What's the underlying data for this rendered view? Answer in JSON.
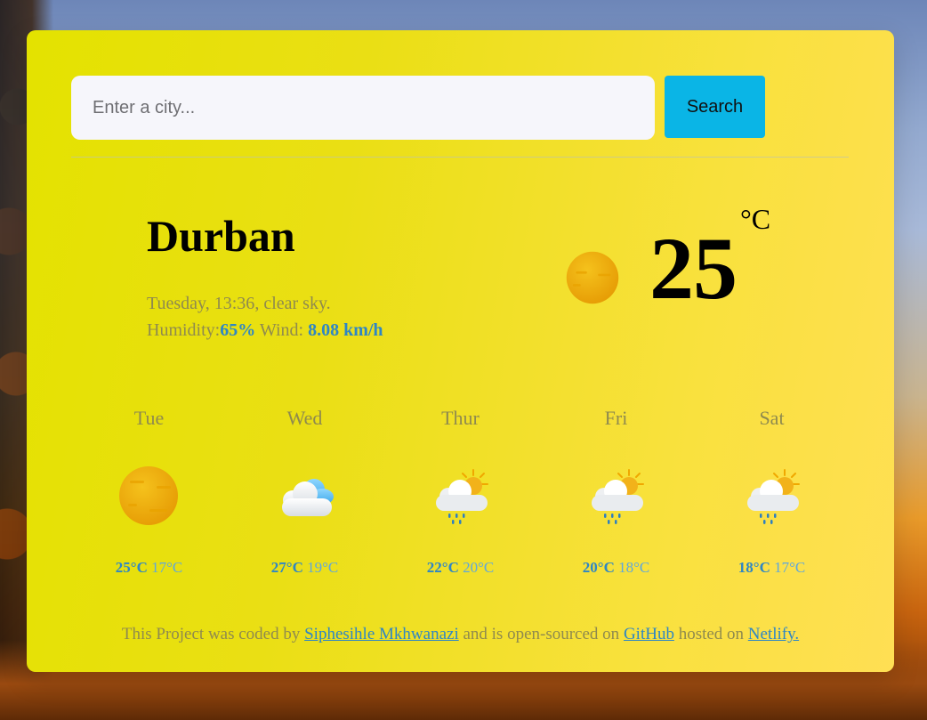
{
  "search": {
    "placeholder": "Enter a city...",
    "value": "",
    "button_label": "Search"
  },
  "current": {
    "city": "Durban",
    "day_time": "Tuesday, 13:36",
    "description": "clear sky",
    "humidity_label": "Humidity:",
    "humidity": "65%",
    "wind_label": "Wind:",
    "wind": "8.08 km/h",
    "temperature": "25",
    "unit": "°C",
    "icon": "sun-icon"
  },
  "forecast": [
    {
      "day": "Tue",
      "icon": "sun-icon",
      "max": "25°C",
      "min": "17°C"
    },
    {
      "day": "Wed",
      "icon": "cloud-icon",
      "max": "27°C",
      "min": "19°C"
    },
    {
      "day": "Thur",
      "icon": "sun-rain-cloud-icon",
      "max": "22°C",
      "min": "20°C"
    },
    {
      "day": "Fri",
      "icon": "sun-rain-cloud-icon",
      "max": "20°C",
      "min": "18°C"
    },
    {
      "day": "Sat",
      "icon": "sun-rain-cloud-icon",
      "max": "18°C",
      "min": "17°C"
    }
  ],
  "footer": {
    "text_before": "This Project was coded by",
    "author_link": "Siphesihle Mkhwanazi",
    "text_middle": "and is open-sourced on",
    "github_link": "GitHub",
    "text_after": "hosted on",
    "netlify_link": "Netlify."
  },
  "colors": {
    "card_background": "#e8e40f",
    "accent_blue": "#2f86c4",
    "button_background": "#0ab5e6",
    "muted_text": "#8f8a4e"
  }
}
